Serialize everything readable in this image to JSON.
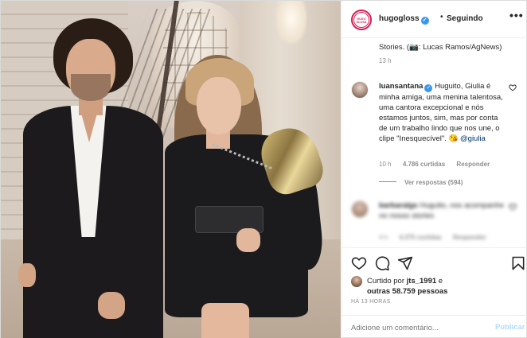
{
  "post": {
    "username": "hugogloss",
    "avatar_logo": "HUGO GLOSS",
    "follow_status": "Seguindo",
    "more_label": "•••"
  },
  "caption": {
    "text": "Stories. (📷: Lucas Ramos/AgNews)",
    "time": "13 h"
  },
  "comments": [
    {
      "username": "luansantana",
      "text": "Huguito, Giulia é minha amiga, uma menina talentosa, uma cantora excepcional e nós estamos juntos, sim, mas por conta de um trabalho lindo que nos une, o clipe \"Inesquecível\". 😘",
      "mention": "@giulia",
      "time": "10 h",
      "likes": "4.786 curtidas",
      "reply_label": "Responder",
      "view_replies": "Ver respostas (594)"
    },
    {
      "username": "barbaralgs",
      "text": "Huguito, nos acompanhe no nosso stories",
      "time": "4 h",
      "likes": "4.375 curtidas",
      "reply_label": "Responder"
    }
  ],
  "likes": {
    "prefix": "Curtido por",
    "user": "jts_1991",
    "joiner": "e",
    "others": "outras 58.759 pessoas"
  },
  "post_time": "HÁ 13 HORAS",
  "comment_box": {
    "placeholder": "Adicione um comentário...",
    "post_label": "Publicar"
  },
  "icons": {
    "heart": "heart-icon",
    "comment": "comment-icon",
    "share": "share-icon",
    "save": "bookmark-icon"
  },
  "colors": {
    "verified": "#3897f0",
    "link": "#00376b",
    "meta": "#8e8e8e",
    "brand": "#d81e55",
    "publish": "#b3dbff"
  }
}
